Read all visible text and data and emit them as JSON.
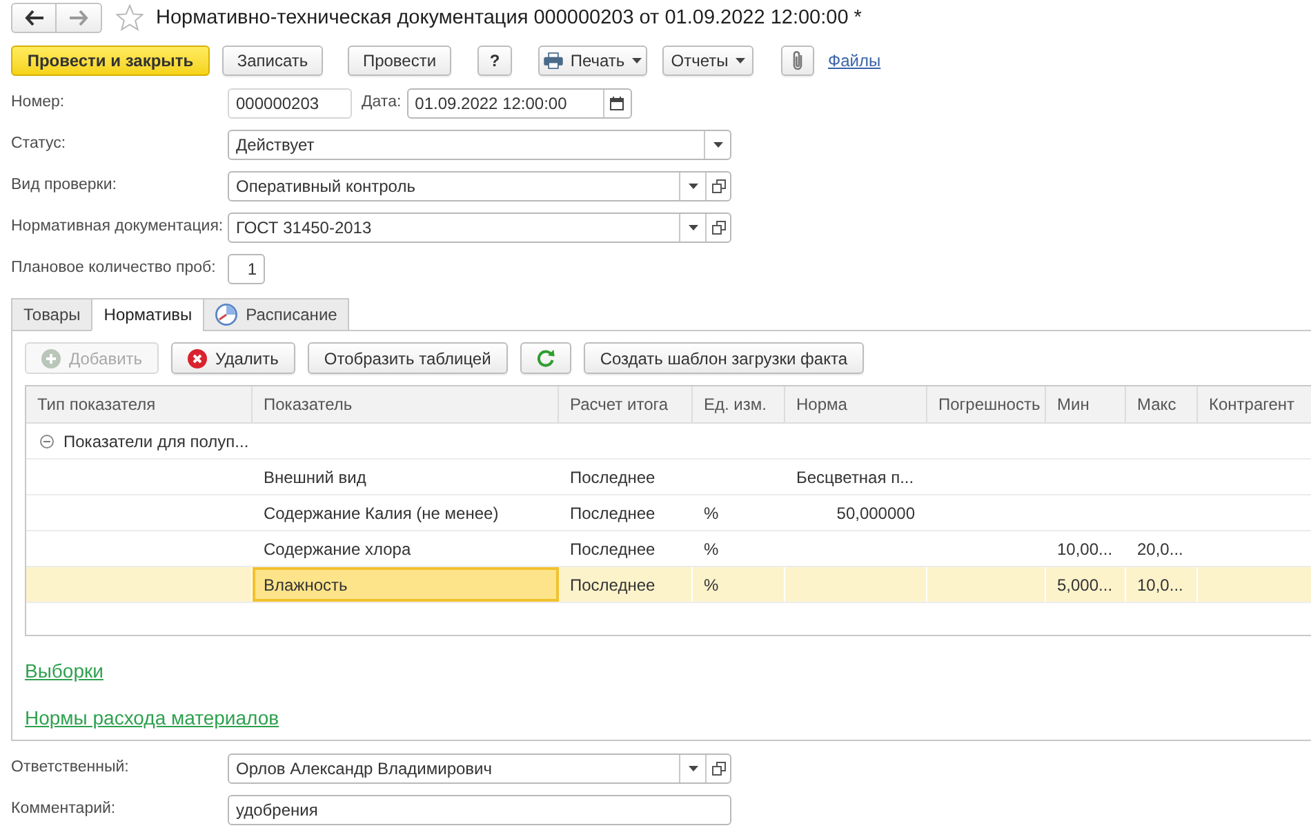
{
  "window": {
    "title": "Нормативно-техническая документация 000000203 от 01.09.2022 12:00:00 *"
  },
  "toolbar": {
    "post_and_close": "Провести и закрыть",
    "save": "Записать",
    "post": "Провести",
    "help": "?",
    "print": "Печать",
    "reports": "Отчеты",
    "files": "Файлы"
  },
  "header": {
    "number": {
      "label": "Номер:",
      "value": "000000203"
    },
    "date": {
      "label": "Дата:",
      "value": "01.09.2022 12:00:00"
    },
    "fields": [
      {
        "kind": "select",
        "label": "Статус:",
        "value": "Действует"
      },
      {
        "kind": "reference",
        "label": "Вид проверки:",
        "value": "Оперативный контроль"
      },
      {
        "kind": "reference",
        "label": "Нормативная документация:",
        "value": "ГОСТ 31450-2013"
      },
      {
        "kind": "count",
        "label": "Плановое количество проб:",
        "value": "1"
      }
    ]
  },
  "tabs": [
    {
      "label": "Товары",
      "selected": false,
      "kind": "plain"
    },
    {
      "label": "Нормативы",
      "selected": true,
      "kind": "plain"
    },
    {
      "label": "Расписание",
      "selected": false,
      "kind": "schedule"
    }
  ],
  "table_toolbar": [
    {
      "kind": "add",
      "label": "Добавить",
      "disabled": true
    },
    {
      "kind": "delete",
      "label": "Удалить",
      "disabled": false
    },
    {
      "kind": "plain",
      "label": "Отобразить таблицей",
      "disabled": false
    },
    {
      "kind": "refresh",
      "disabled": false
    },
    {
      "kind": "plain",
      "label": "Создать шаблон загрузки факта",
      "disabled": false
    }
  ],
  "table": {
    "columns": [
      "Тип показателя",
      "Показатель",
      "Расчет итога",
      "Ед. изм.",
      "Норма",
      "Погрешность",
      "Мин",
      "Макс",
      "Контрагент"
    ],
    "rows": [
      {
        "kind": "group",
        "label": "Показатели для полуп...",
        "expanded": true,
        "selected": false,
        "children": [
          {
            "kind": "qualitative",
            "selected": false,
            "indicator": "Внешний вид",
            "total_calculation": "Последнее",
            "norm": "Бесцветная п..."
          },
          {
            "kind": "quantitative",
            "selected": false,
            "indicator": "Содержание Калия (не менее)",
            "total_calculation": "Последнее",
            "unit": "%",
            "norm": "50,000000"
          },
          {
            "kind": "quantitative",
            "selected": false,
            "indicator": "Содержание хлора",
            "total_calculation": "Последнее",
            "unit": "%",
            "min": "10,00...",
            "max": "20,0..."
          },
          {
            "kind": "quantitative",
            "selected": true,
            "indicator": "Влажность",
            "total_calculation": "Последнее",
            "unit": "%",
            "min": "5,000...",
            "max": "10,0..."
          }
        ]
      }
    ]
  },
  "links": [
    "Выборки",
    "Нормы расхода материалов"
  ],
  "footer_fields": [
    {
      "kind": "reference",
      "label": "Ответственный:",
      "value": "Орлов Александр Владимирович"
    },
    {
      "kind": "text",
      "label": "Комментарий:",
      "value": "удобрения"
    }
  ]
}
